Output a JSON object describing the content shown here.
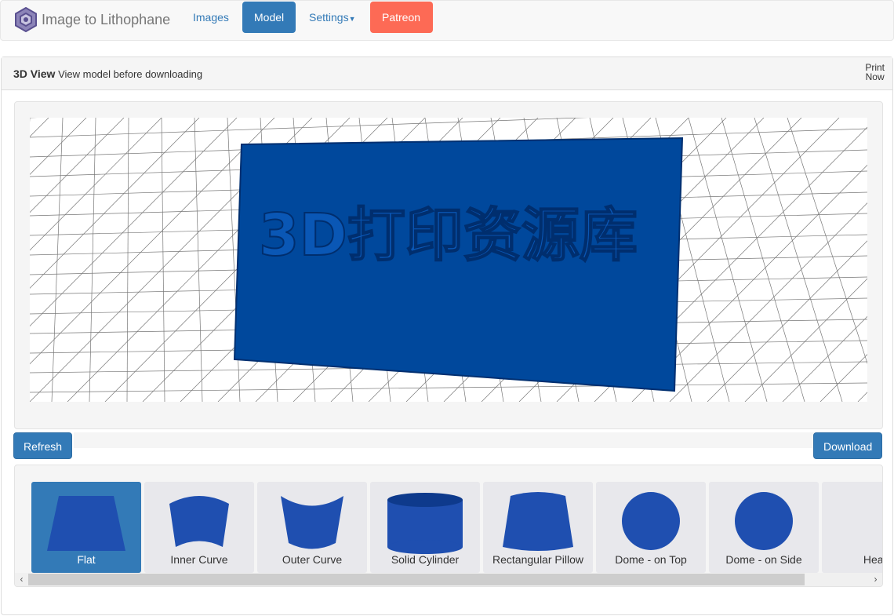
{
  "navbar": {
    "brand": "Image to Lithophane",
    "items": [
      {
        "label": "Images",
        "active": false
      },
      {
        "label": "Model",
        "active": true
      },
      {
        "label": "Settings",
        "dropdown": true
      },
      {
        "label": "Patreon",
        "color": "#fd6a55"
      }
    ]
  },
  "panel": {
    "title": "3D View",
    "subtitle": "View model before downloading",
    "print_now": [
      "Print",
      "Now"
    ]
  },
  "viewer": {
    "model_text": "3D打印资源库",
    "model_color": "#00489c"
  },
  "actions": {
    "refresh": "Refresh",
    "download": "Download"
  },
  "shapes": [
    {
      "label": "Flat",
      "selected": true
    },
    {
      "label": "Inner Curve"
    },
    {
      "label": "Outer Curve"
    },
    {
      "label": "Solid Cylinder"
    },
    {
      "label": "Rectangular Pillow"
    },
    {
      "label": "Dome - on Top"
    },
    {
      "label": "Dome - on Side"
    },
    {
      "label": "Heart"
    }
  ],
  "colors": {
    "primary": "#337ab7",
    "patreon": "#fd6a55"
  }
}
